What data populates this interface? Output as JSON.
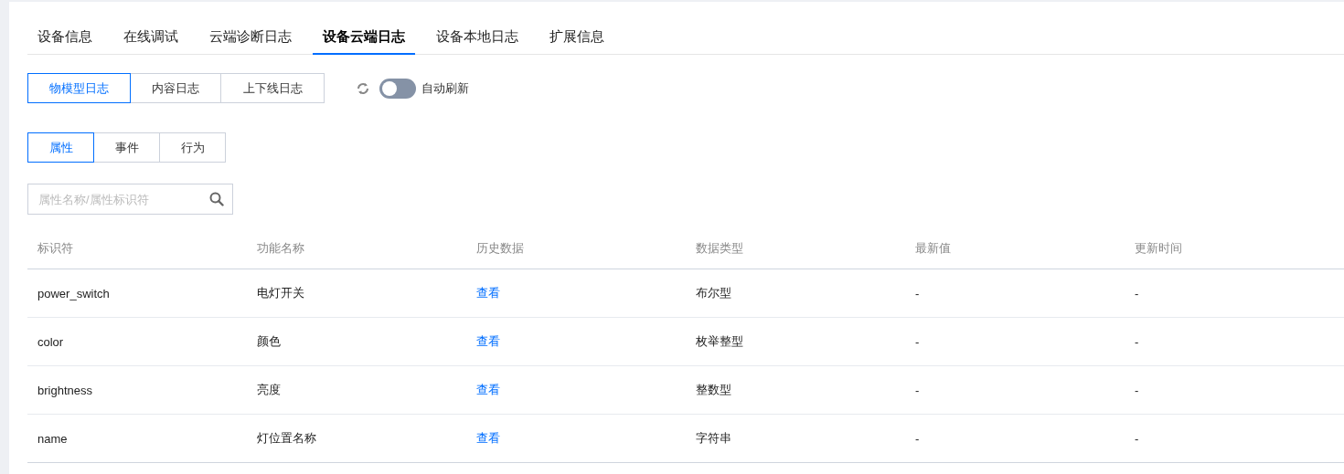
{
  "tabs": [
    {
      "label": "设备信息",
      "selected": false
    },
    {
      "label": "在线调试",
      "selected": false
    },
    {
      "label": "云端诊断日志",
      "selected": false
    },
    {
      "label": "设备云端日志",
      "selected": true
    },
    {
      "label": "设备本地日志",
      "selected": false
    },
    {
      "label": "扩展信息",
      "selected": false
    }
  ],
  "log_types": [
    {
      "label": "物模型日志",
      "selected": true
    },
    {
      "label": "内容日志",
      "selected": false
    },
    {
      "label": "上下线日志",
      "selected": false
    }
  ],
  "auto_refresh": {
    "label": "自动刷新",
    "on": false
  },
  "categories": [
    {
      "label": "属性",
      "selected": true
    },
    {
      "label": "事件",
      "selected": false
    },
    {
      "label": "行为",
      "selected": false
    }
  ],
  "search": {
    "placeholder": "属性名称/属性标识符"
  },
  "table": {
    "columns": [
      "标识符",
      "功能名称",
      "历史数据",
      "数据类型",
      "最新值",
      "更新时间"
    ],
    "rows": [
      {
        "id": "power_switch",
        "name": "电灯开关",
        "history": "查看",
        "type": "布尔型",
        "latest": "-",
        "updated": "-"
      },
      {
        "id": "color",
        "name": "颜色",
        "history": "查看",
        "type": "枚举整型",
        "latest": "-",
        "updated": "-"
      },
      {
        "id": "brightness",
        "name": "亮度",
        "history": "查看",
        "type": "整数型",
        "latest": "-",
        "updated": "-"
      },
      {
        "id": "name",
        "name": "灯位置名称",
        "history": "查看",
        "type": "字符串",
        "latest": "-",
        "updated": "-"
      }
    ]
  }
}
